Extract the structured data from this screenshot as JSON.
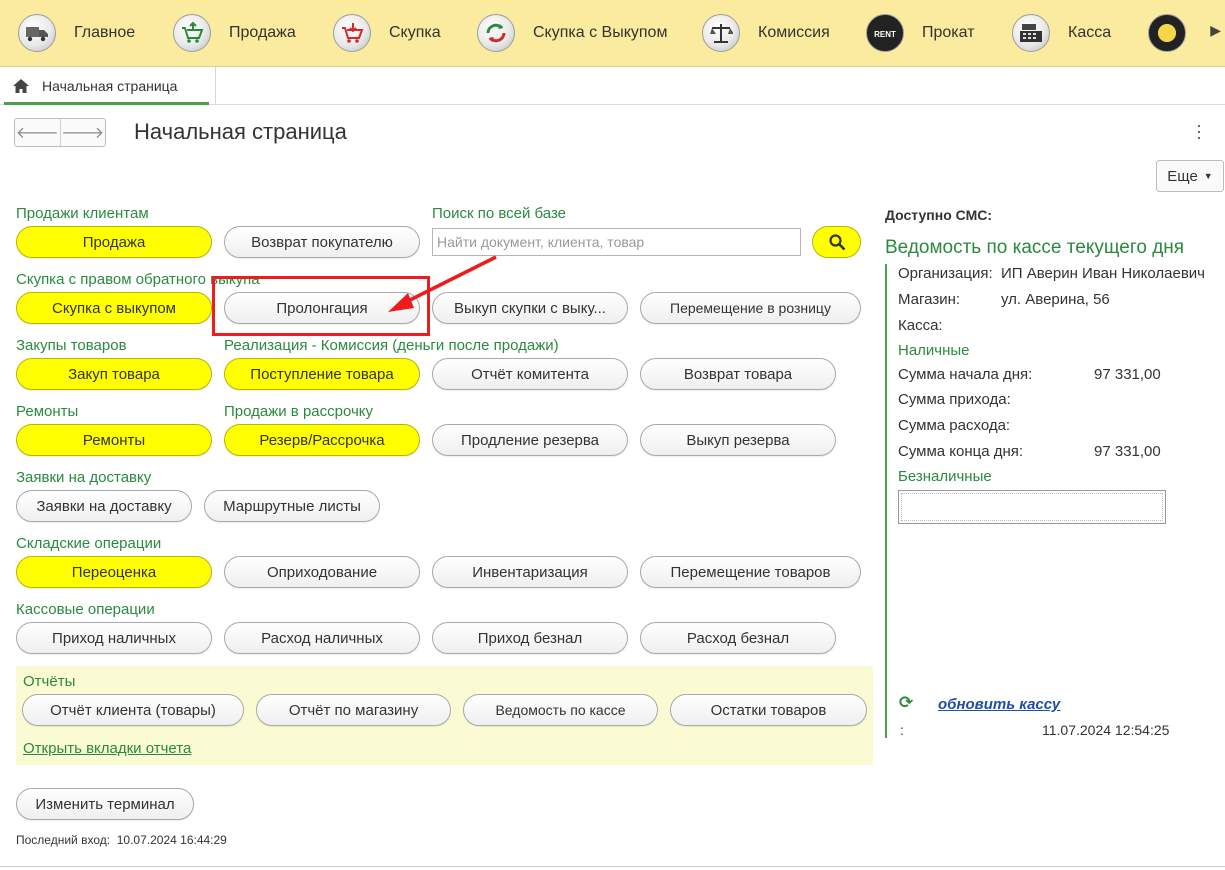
{
  "topnav": {
    "items": [
      {
        "label": "Главное",
        "icon": "truck-icon"
      },
      {
        "label": "Продажа",
        "icon": "cart-up-icon"
      },
      {
        "label": "Скупка",
        "icon": "cart-down-icon"
      },
      {
        "label": "Скупка с Выкупом",
        "icon": "cycle-arrows-icon"
      },
      {
        "label": "Комиссия",
        "icon": "scales-icon"
      },
      {
        "label": "Прокат",
        "icon": "rent-icon"
      },
      {
        "label": "Касса",
        "icon": "cash-register-icon"
      }
    ]
  },
  "tab": {
    "label": "Начальная страница"
  },
  "page": {
    "title": "Начальная страница",
    "more_label": "Еще"
  },
  "groups": {
    "sales": "Продажи клиентам",
    "search": "Поиск по всей базе",
    "buyback": "Скупка с правом обратного выкупа",
    "purchases": "Закупы товаров",
    "commission": "Реализация - Комиссия (деньги после продажи)",
    "repairs": "Ремонты",
    "installments": "Продажи в рассрочку",
    "delivery": "Заявки на доставку",
    "warehouse": "Складские операции",
    "cash_ops": "Кассовые операции",
    "reports": "Отчёты"
  },
  "buttons": {
    "sale": "Продажа",
    "return_to_customer": "Возврат покупателю",
    "buyback": "Скупка с выкупом",
    "prolongation": "Пролонгация",
    "redeem_buyback": "Выкуп скупки с выку...",
    "move_to_retail": "Перемещение в розницу",
    "purchase_goods": "Закуп товара",
    "goods_receipt": "Поступление товара",
    "consignor_report": "Отчёт комитента",
    "return_goods": "Возврат товара",
    "repairs": "Ремонты",
    "reserve_installment": "Резерв/Рассрочка",
    "extend_reserve": "Продление резерва",
    "redeem_reserve": "Выкуп резерва",
    "delivery_requests": "Заявки на доставку",
    "route_sheets": "Маршрутные листы",
    "revaluation": "Переоценка",
    "posting": "Оприходование",
    "inventory": "Инвентаризация",
    "move_goods": "Перемещение товаров",
    "cash_in": "Приход наличных",
    "cash_out": "Расход наличных",
    "noncash_in": "Приход безнал",
    "noncash_out": "Расход безнал",
    "client_report": "Отчёт клиента (товары)",
    "store_report": "Отчёт по магазину",
    "cash_statement": "Ведомость по кассе",
    "stock_balance": "Остатки товаров",
    "change_terminal": "Изменить терминал"
  },
  "search": {
    "placeholder": "Найти документ, клиента, товар"
  },
  "reports_link": "Открыть вкладки отчета",
  "last_login": {
    "label": "Последний вход:",
    "value": "10.07.2024 16:44:29"
  },
  "right": {
    "sms_label": "Доступно СМС:",
    "title": "Ведомость по кассе текущего дня",
    "org_label": "Организация:",
    "org_value": "ИП Аверин Иван Николаевич",
    "store_label": "Магазин:",
    "store_value": "ул. Аверина, 56",
    "cashbox_label": "Касса:",
    "cash_section": "Наличные",
    "start_label": "Сумма начала дня:",
    "start_value": "97 331,00",
    "income_label": "Сумма прихода:",
    "expense_label": "Сумма расхода:",
    "end_label": "Сумма конца дня:",
    "end_value": "97 331,00",
    "cashless_section": "Безналичные",
    "refresh_link": "обновить кассу",
    "colon": ":",
    "timestamp": "11.07.2024 12:54:25"
  },
  "colors": {
    "accent_green": "#2b8a3e",
    "highlight_yellow": "#ffff00",
    "menu_bg": "#fbeb9e",
    "annotation_red": "#ee1c1c"
  }
}
